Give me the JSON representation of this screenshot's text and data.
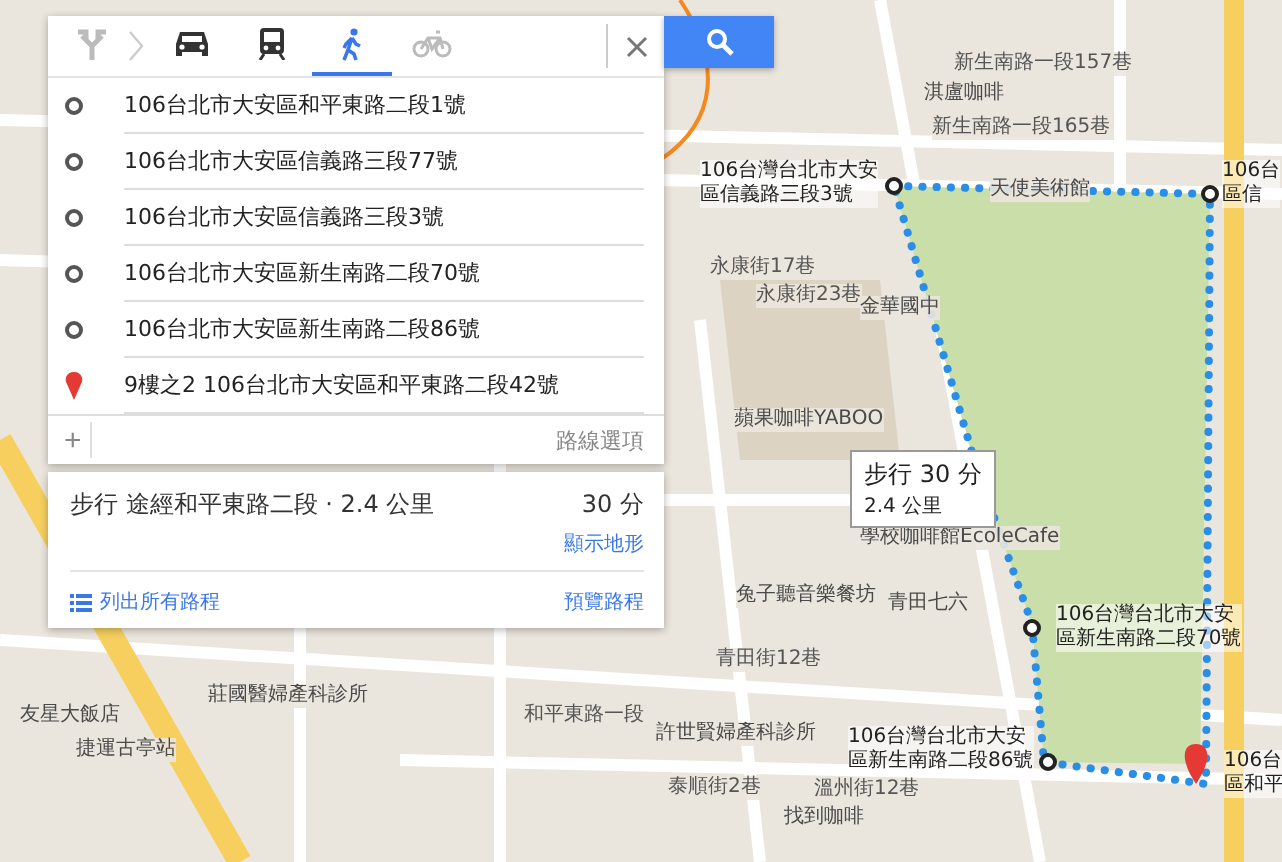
{
  "mode_tabs": [
    {
      "kind": "directions",
      "selected": false
    },
    {
      "kind": "car",
      "selected": false
    },
    {
      "kind": "transit",
      "selected": false
    },
    {
      "kind": "walk",
      "selected": true
    },
    {
      "kind": "bike",
      "selected": false
    }
  ],
  "waypoints": [
    {
      "kind": "stop",
      "text": "106台北市大安區和平東路二段1號"
    },
    {
      "kind": "stop",
      "text": "106台北市大安區信義路三段77號"
    },
    {
      "kind": "stop",
      "text": "106台北市大安區信義路三段3號"
    },
    {
      "kind": "stop",
      "text": "106台北市大安區新生南路二段70號"
    },
    {
      "kind": "stop",
      "text": "106台北市大安區新生南路二段86號"
    },
    {
      "kind": "destination",
      "text": "9樓之2 106台北市大安區和平東路二段42號"
    }
  ],
  "add_button": "+",
  "route_options": "路線選項",
  "route": {
    "summary": "步行 途經和平東路二段 · 2.4 公里",
    "duration": "30 分",
    "terrain_link": "顯示地形",
    "list_link": "列出所有路程",
    "preview_link": "預覽路程"
  },
  "map": {
    "labels": [
      {
        "kind": "street",
        "text": "新生南路一段157巷"
      },
      {
        "kind": "poi",
        "text": "淇盧咖啡"
      },
      {
        "kind": "street",
        "text": "新生南路一段165巷"
      },
      {
        "kind": "poi",
        "text": "天使美術館"
      },
      {
        "kind": "street",
        "text": "永康街17巷"
      },
      {
        "kind": "street",
        "text": "永康街23巷"
      },
      {
        "kind": "poi",
        "text": "金華國中"
      },
      {
        "kind": "poi",
        "text": "蘋果咖啡YABOO"
      },
      {
        "kind": "poi",
        "text": "學校咖啡館EcoleCafe"
      },
      {
        "kind": "poi",
        "text": "兔子聽音樂餐坊"
      },
      {
        "kind": "poi",
        "text": "青田七六"
      },
      {
        "kind": "street",
        "text": "青田街12巷"
      },
      {
        "kind": "poi",
        "text": "莊國醫婦產科診所"
      },
      {
        "kind": "poi",
        "text": "友星大飯店"
      },
      {
        "kind": "poi",
        "text": "捷運古亭站"
      },
      {
        "kind": "street",
        "text": "和平東路一段"
      },
      {
        "kind": "poi",
        "text": "許世賢婦產科診所"
      },
      {
        "kind": "street",
        "text": "泰順街2巷"
      },
      {
        "kind": "street",
        "text": "溫州街12巷"
      },
      {
        "kind": "poi",
        "text": "找到咖啡"
      }
    ],
    "waypoint_labels": [
      {
        "lines": [
          "106台灣台北市大安",
          "區信義路三段3號"
        ]
      },
      {
        "lines": [
          "106台",
          "區信"
        ]
      },
      {
        "lines": [
          "106台灣台北市大安",
          "區新生南路二段70號"
        ]
      },
      {
        "lines": [
          "106台灣台北市大安",
          "區新生南路二段86號"
        ]
      },
      {
        "lines": [
          "106台",
          "區和平"
        ]
      }
    ],
    "callout": {
      "title": "步行 30 分",
      "distance": "2.4 公里"
    }
  }
}
